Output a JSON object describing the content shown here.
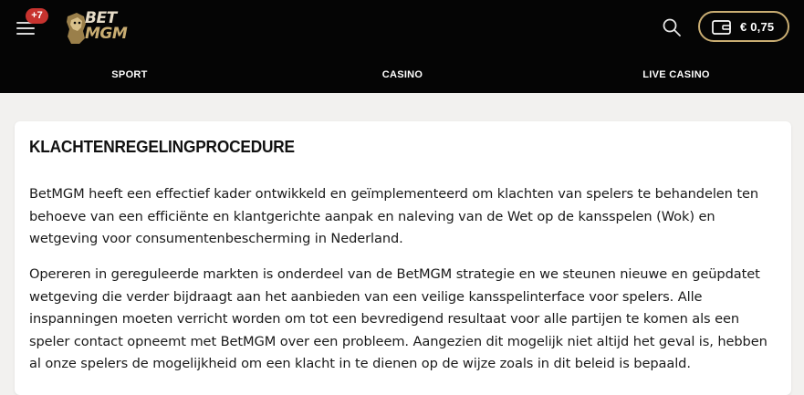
{
  "header": {
    "notification_count": "+7",
    "logo": {
      "line1": "BET",
      "line2": "MGM"
    },
    "balance": "€ 0,75",
    "icons": {
      "menu": "hamburger-icon",
      "search": "search-icon",
      "wallet": "wallet-icon"
    },
    "colors": {
      "background": "#050505",
      "accent_gold": "#c9ad72",
      "badge_red": "#c7332f"
    }
  },
  "nav": {
    "items": [
      {
        "label": "SPORT"
      },
      {
        "label": "CASINO"
      },
      {
        "label": "LIVE CASINO"
      }
    ]
  },
  "content": {
    "title": "KLACHTENREGELINGPROCEDURE",
    "paragraphs": [
      "BetMGM heeft een effectief kader ontwikkeld en geïmplementeerd om klachten van spelers te behandelen ten behoeve van een efficiënte en klantgerichte aanpak en naleving van de Wet op de kansspelen (Wok) en wetgeving voor consumentenbescherming in Nederland.",
      "Opereren in gereguleerde markten is onderdeel van de BetMGM strategie en we steunen nieuwe en geüpdatet wetgeving die verder bijdraagt aan het aanbieden van een veilige kansspelinterface voor spelers. Alle inspanningen moeten verricht worden om tot een bevredigend resultaat voor alle partijen te komen als een speler contact opneemt met BetMGM over een probleem. Aangezien dit mogelijk niet altijd het geval is, hebben al onze spelers de mogelijkheid om een klacht in te dienen op de wijze zoals in dit beleid is bepaald."
    ]
  }
}
